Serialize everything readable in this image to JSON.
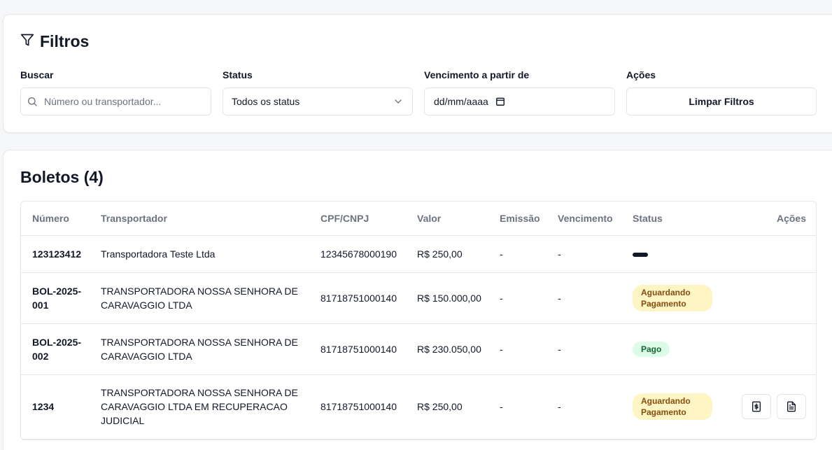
{
  "filters": {
    "title": "Filtros",
    "search": {
      "label": "Buscar",
      "placeholder": "Número ou transportador...",
      "value": ""
    },
    "status": {
      "label": "Status",
      "selected": "Todos os status"
    },
    "due_date": {
      "label": "Vencimento a partir de",
      "value": "dd/mm/aaaa"
    },
    "actions": {
      "label": "Ações",
      "clear_label": "Limpar Filtros"
    }
  },
  "boletos": {
    "title": "Boletos (4)",
    "columns": [
      "Número",
      "Transportador",
      "CPF/CNPJ",
      "Valor",
      "Emissão",
      "Vencimento",
      "Status",
      "Ações"
    ],
    "rows": [
      {
        "numero": "123123412",
        "transportador": "Transportadora Teste Ltda",
        "cnpj": "12345678000190",
        "valor": "R$ 250,00",
        "emissao": "-",
        "vencimento": "-",
        "status": ""
      },
      {
        "numero": "BOL-2025-001",
        "transportador": "TRANSPORTADORA NOSSA SENHORA DE CARAVAGGIO LTDA",
        "cnpj": "81718751000140",
        "valor": "R$ 150.000,00",
        "emissao": "-",
        "vencimento": "-",
        "status": "Aguardando Pagamento"
      },
      {
        "numero": "BOL-2025-002",
        "transportador": "TRANSPORTADORA NOSSA SENHORA DE CARAVAGGIO LTDA",
        "cnpj": "81718751000140",
        "valor": "R$ 230.050,00",
        "emissao": "-",
        "vencimento": "-",
        "status": "Pago"
      },
      {
        "numero": "1234",
        "transportador": "TRANSPORTADORA NOSSA SENHORA DE CARAVAGGIO LTDA EM RECUPERACAO JUDICIAL",
        "cnpj": "81718751000140",
        "valor": "R$ 250,00",
        "emissao": "-",
        "vencimento": "-",
        "status": "Aguardando Pagamento",
        "actions": [
          "dollar-file-icon",
          "file-text-icon"
        ]
      }
    ]
  },
  "colors": {
    "badge_waiting_bg": "#fef5c4",
    "badge_waiting_text": "#854d0e",
    "badge_paid_bg": "#dcfce7",
    "badge_paid_text": "#166534"
  }
}
